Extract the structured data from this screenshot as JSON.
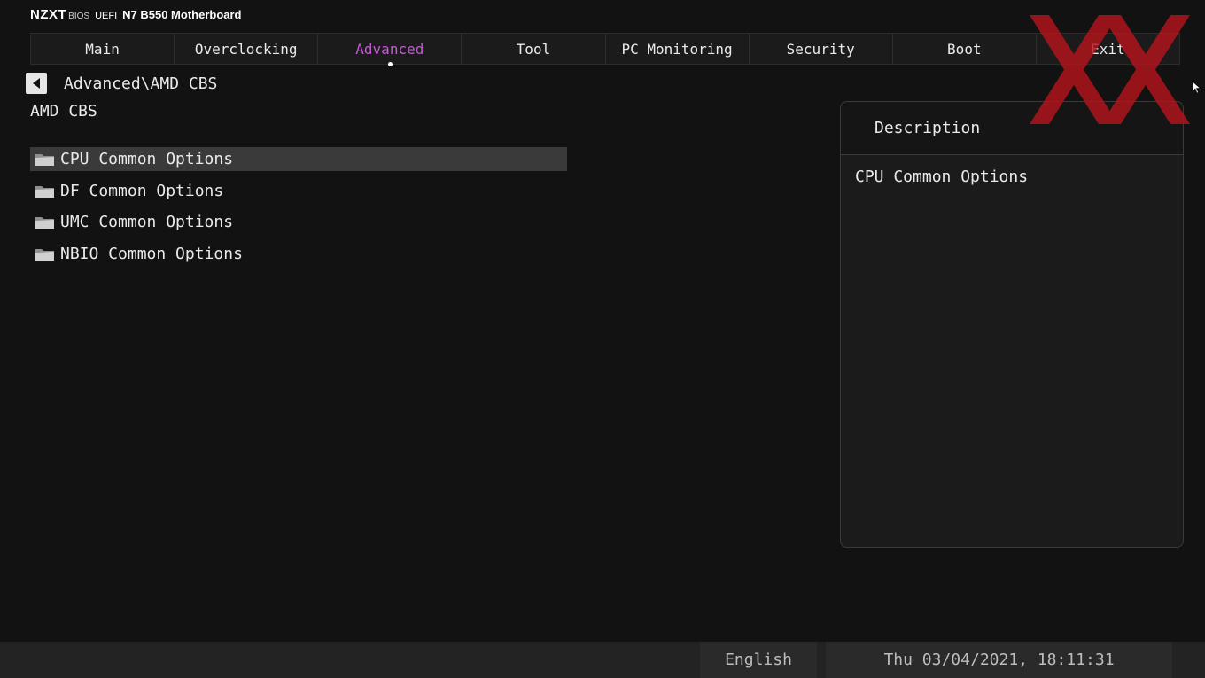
{
  "brand": {
    "logo": "NZXT",
    "bios": "BIOS",
    "uefi": "UEFI",
    "model": "N7 B550 Motherboard"
  },
  "tabs": [
    {
      "label": "Main"
    },
    {
      "label": "Overclocking"
    },
    {
      "label": "Advanced",
      "active": true
    },
    {
      "label": "Tool"
    },
    {
      "label": "PC Monitoring"
    },
    {
      "label": "Security"
    },
    {
      "label": "Boot"
    },
    {
      "label": "Exit"
    }
  ],
  "navigation": {
    "back_icon": "triangle-left-icon",
    "breadcrumb": "Advanced\\AMD CBS"
  },
  "page": {
    "title": "AMD CBS"
  },
  "menu": {
    "item_icon": "folder-icon",
    "items": [
      {
        "label": "CPU Common Options",
        "selected": true
      },
      {
        "label": "DF Common Options"
      },
      {
        "label": "UMC Common Options"
      },
      {
        "label": "NBIO Common Options"
      }
    ]
  },
  "description": {
    "header": "Description",
    "text": "CPU Common Options"
  },
  "status": {
    "language": "English",
    "datetime": "Thu 03/04/2021, 18:11:31"
  },
  "colors": {
    "accent": "#c25bd1",
    "background": "#121212",
    "watermark": "#b3141c"
  }
}
